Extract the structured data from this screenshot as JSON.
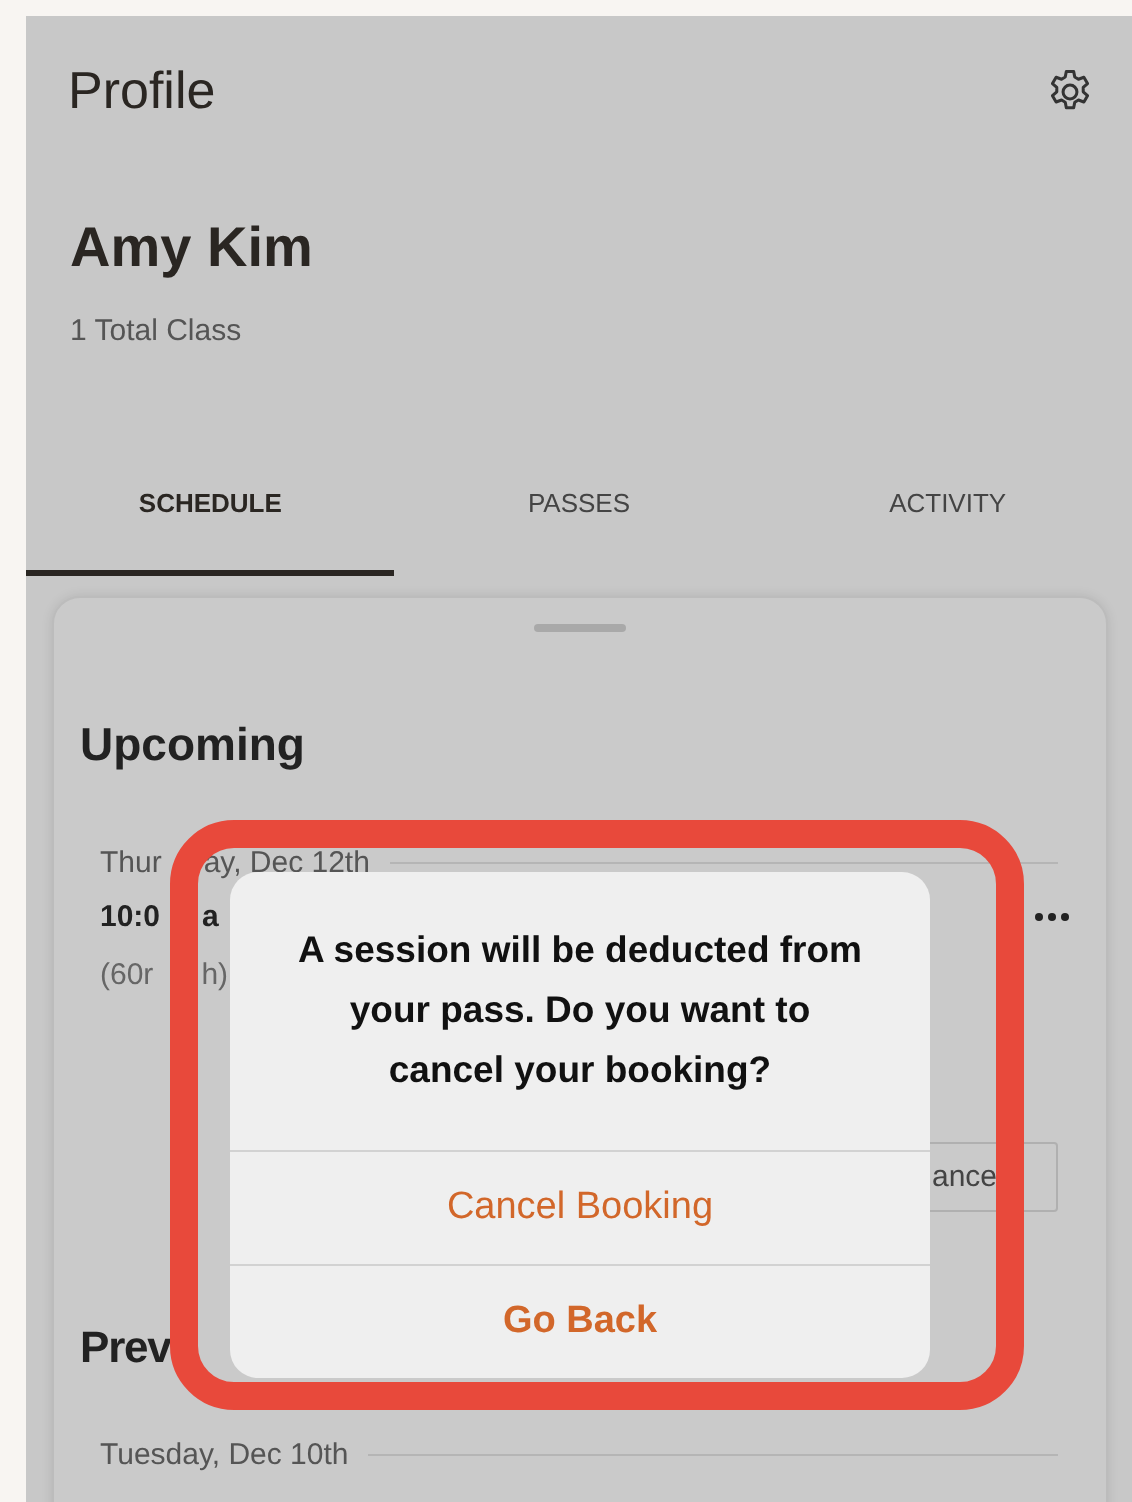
{
  "header": {
    "title": "Profile"
  },
  "profile": {
    "name": "Amy Kim",
    "subtitle": "1 Total Class"
  },
  "tabs": [
    {
      "label": "SCHEDULE",
      "selected": true
    },
    {
      "label": "PASSES",
      "selected": false
    },
    {
      "label": "ACTIVITY",
      "selected": false
    }
  ],
  "upcoming": {
    "heading": "Upcoming",
    "date_parts": [
      "Thur",
      "ay, Dec 12th"
    ],
    "time_parts": [
      "10:0",
      "a"
    ],
    "duration_parts": [
      "(60r",
      "h)"
    ],
    "button_text": "ance"
  },
  "previous": {
    "heading": "Prev",
    "date": "Tuesday, Dec 10th"
  },
  "dialog": {
    "message": "A session will be deducted from your pass. Do you want to cancel your booking?",
    "actions": [
      {
        "label": "Cancel Booking",
        "kind": "normal"
      },
      {
        "label": "Go Back",
        "kind": "preferred"
      }
    ]
  }
}
